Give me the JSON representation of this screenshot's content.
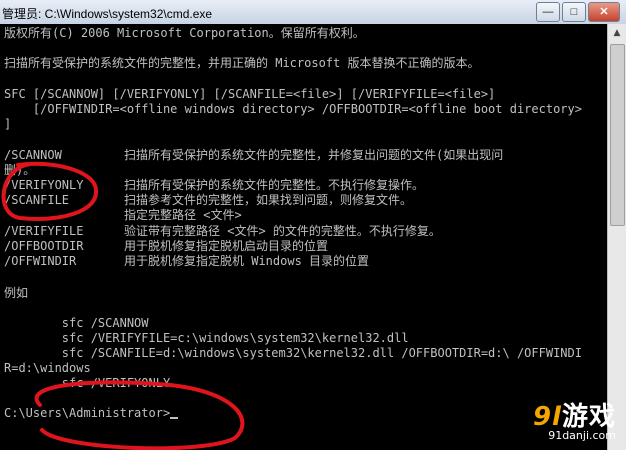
{
  "window": {
    "title": "管理员: C:\\Windows\\system32\\cmd.exe",
    "buttons": {
      "minimize": "—",
      "maximize": "□",
      "close": "✕"
    }
  },
  "console": {
    "lines": [
      "版权所有(C) 2006 Microsoft Corporation。保留所有权利。",
      "扫描所有受保护的系统文件的完整性，并用正确的 Microsoft 版本替换不正确的版本。",
      "SFC [/SCANNOW] [/VERIFYONLY] [/SCANFILE=<file>] [/VERIFYFILE=<file>]",
      "    [/OFFWINDIR=<offline windows directory> /OFFBOOTDIR=<offline boot directory>",
      "]",
      "/SCANNOW",
      "删)。",
      "/VERIFYONLY",
      "/SCANFILE",
      "/VERIFYFILE",
      "/OFFBOOTDIR",
      "/OFFWINDIR",
      "例如",
      "        sfc /SCANNOW",
      "        sfc /VERIFYFILE=c:\\windows\\system32\\kernel32.dll",
      "        sfc /SCANFILE=d:\\windows\\system32\\kernel32.dll /OFFBOOTDIR=d:\\ /OFFWINDI",
      "R=d:\\windows",
      "        sfc /VERIFYONLY",
      "C:\\Users\\Administrator>"
    ],
    "descriptions": [
      "扫描所有受保护的系统文件的完整性，并修复出问题的文件(如果出现问",
      "扫描所有受保护的系统文件的完整性。不执行修复操作。",
      "扫描参考文件的完整性，如果找到问题，则修复文件。",
      "指定完整路径 <文件>",
      "验证带有完整路径 <文件> 的文件的完整性。不执行修复。",
      "用于脱机修复指定脱机启动目录的位置",
      "用于脱机修复指定脱机 Windows 目录的位置"
    ]
  },
  "watermark": {
    "logo_num": "9l",
    "logo_text": "游戏",
    "url": "91danji.com"
  }
}
